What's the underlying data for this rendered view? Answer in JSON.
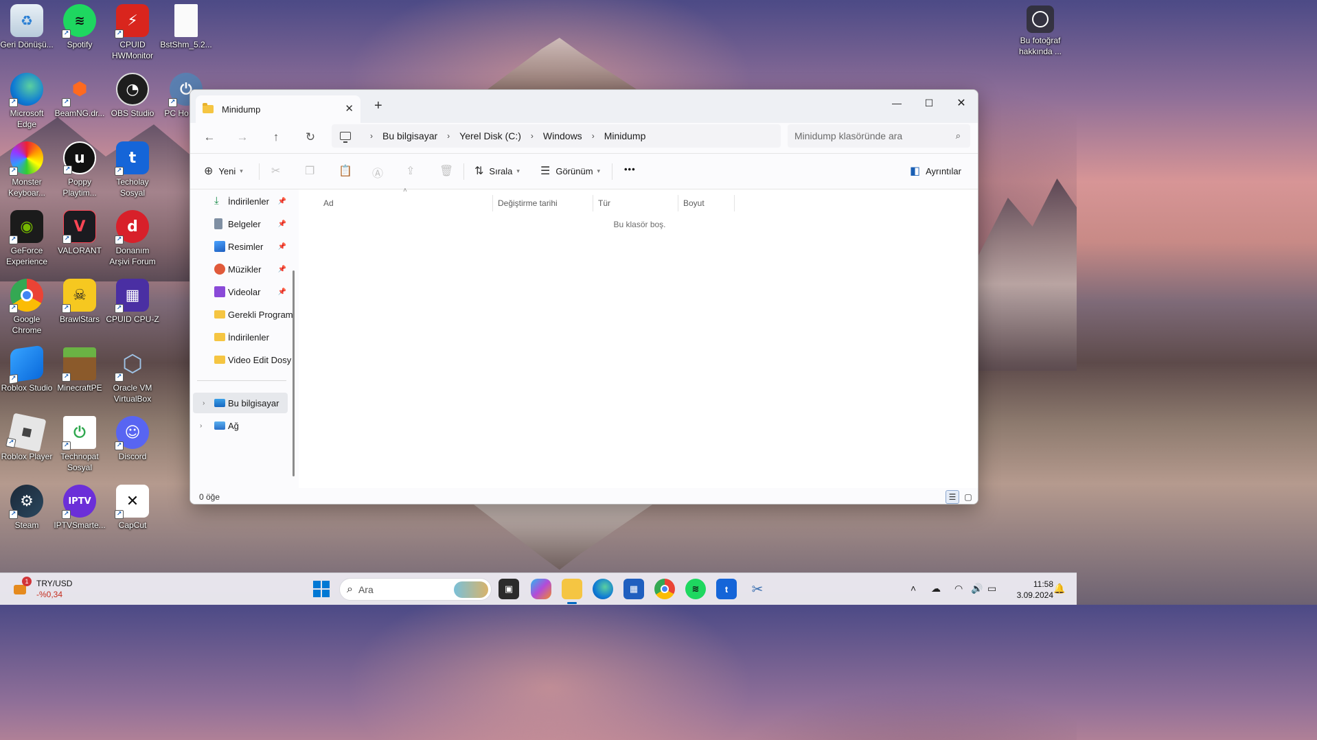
{
  "desktop": {
    "icons": [
      {
        "label": "Geri Dönüşü...",
        "icon": "recycle-bin-icon"
      },
      {
        "label": "Spotify",
        "icon": "spotify-icon"
      },
      {
        "label": "CPUID HWMonitor",
        "icon": "hwmonitor-icon"
      },
      {
        "label": "BstShm_5.2...",
        "icon": "file-icon"
      },
      {
        "label": "Microsoft Edge",
        "icon": "edge-icon"
      },
      {
        "label": "BeamNG.dr...",
        "icon": "beamng-icon"
      },
      {
        "label": "OBS Studio",
        "icon": "obs-icon"
      },
      {
        "label": "PC Ho Foru",
        "icon": "pc-forum-icon"
      },
      {
        "label": "Monster Keyboar...",
        "icon": "monster-keyboard-icon"
      },
      {
        "label": "Poppy Playtim...",
        "icon": "unreal-icon"
      },
      {
        "label": "Techolay Sosyal",
        "icon": "techolay-icon"
      },
      {
        "label": "GeForce Experience",
        "icon": "geforce-icon"
      },
      {
        "label": "VALORANT",
        "icon": "valorant-icon"
      },
      {
        "label": "Donanım Arşivi Forum",
        "icon": "donanim-icon"
      },
      {
        "label": "Google Chrome",
        "icon": "chrome-icon"
      },
      {
        "label": "BrawlStars",
        "icon": "brawlstars-icon"
      },
      {
        "label": "CPUID CPU-Z",
        "icon": "cpuz-icon"
      },
      {
        "label": "Roblox Studio",
        "icon": "roblox-studio-icon"
      },
      {
        "label": "MinecraftPE",
        "icon": "minecraft-icon"
      },
      {
        "label": "Oracle VM VirtualBox",
        "icon": "virtualbox-icon"
      },
      {
        "label": "Roblox Player",
        "icon": "roblox-icon"
      },
      {
        "label": "Technopat Sosyal",
        "icon": "technopat-icon"
      },
      {
        "label": "Discord",
        "icon": "discord-icon"
      },
      {
        "label": "Steam",
        "icon": "steam-icon"
      },
      {
        "label": "IPTVSmarte...",
        "icon": "iptv-icon"
      },
      {
        "label": "CapCut",
        "icon": "capcut-icon"
      }
    ],
    "about_photo": "Bu fotoğraf hakkında ..."
  },
  "window": {
    "tab_title": "Minidump",
    "new_tab": "+",
    "breadcrumb": [
      "Bu bilgisayar",
      "Yerel Disk (C:)",
      "Windows",
      "Minidump"
    ],
    "search_placeholder": "Minidump klasöründe ara",
    "commands": {
      "new": "Yeni",
      "sort": "Sırala",
      "view": "Görünüm",
      "more": "•••",
      "details": "Ayrıntılar"
    },
    "sidebar": {
      "quick_access": [
        {
          "label": "İndirilenler",
          "pinned": true
        },
        {
          "label": "Belgeler",
          "pinned": true
        },
        {
          "label": "Resimler",
          "pinned": true
        },
        {
          "label": "Müzikler",
          "pinned": true
        },
        {
          "label": "Videolar",
          "pinned": true
        },
        {
          "label": "Gerekli Program",
          "pinned": false
        },
        {
          "label": "İndirilenler",
          "pinned": false
        },
        {
          "label": "Video Edit Dosy",
          "pinned": false
        }
      ],
      "this_pc": "Bu bilgisayar",
      "network": "Ağ"
    },
    "columns": {
      "name": "Ad",
      "modified": "Değiştirme tarihi",
      "type": "Tür",
      "size": "Boyut"
    },
    "empty_message": "Bu klasör boş.",
    "item_count": "0 öğe"
  },
  "taskbar": {
    "search_placeholder": "Ara",
    "weather_symbol": "TRY/USD",
    "weather_value": "-%0,34",
    "weather_badge": "1",
    "time": "11:58",
    "date": "3.09.2024"
  }
}
